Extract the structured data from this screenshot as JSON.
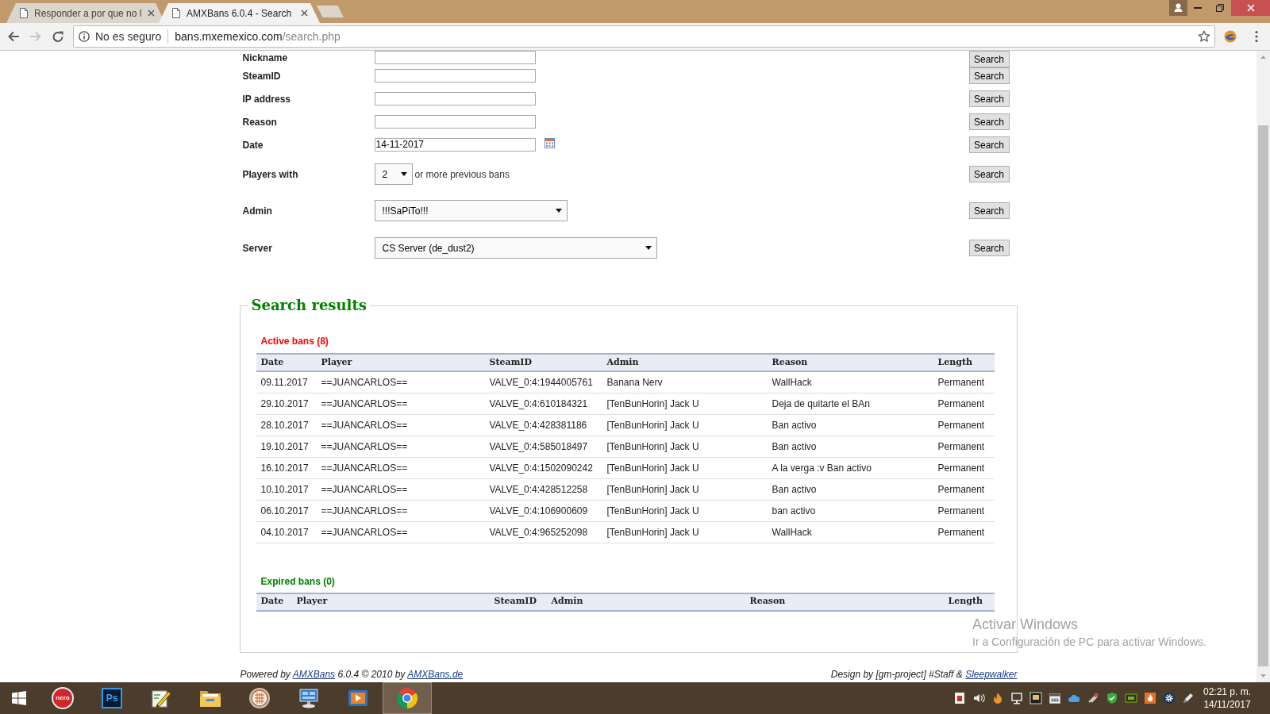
{
  "browser": {
    "tabs": [
      {
        "title": "Responder a por que no l",
        "selected": false
      },
      {
        "title": "AMXBans 6.0.4 - Search",
        "selected": true
      }
    ],
    "security_label": "No es seguro",
    "url_host": "bans.mxemexico.com",
    "url_path": "/search.php"
  },
  "search_form": {
    "rows": [
      {
        "label": "Nickname",
        "kind": "text",
        "button": "Search"
      },
      {
        "label": "SteamID",
        "kind": "text",
        "button": "Search"
      },
      {
        "label": "IP address",
        "kind": "text",
        "button": "Search"
      },
      {
        "label": "Reason",
        "kind": "text",
        "button": "Search"
      },
      {
        "label": "Date",
        "kind": "date",
        "value": "14-11-2017",
        "button": "Search"
      },
      {
        "label": "Players with",
        "kind": "count",
        "value": "2",
        "suffix": "or more previous bans",
        "button": "Search"
      },
      {
        "label": "Admin",
        "kind": "select",
        "value": "!!!SaPiTo!!!",
        "button": "Search"
      },
      {
        "label": "Server",
        "kind": "wideselect",
        "value": "CS Server (de_dust2)",
        "button": "Search"
      }
    ]
  },
  "results": {
    "title": "Search results",
    "sections": [
      {
        "heading": "Active bans (8)",
        "color": "#ff0000",
        "columns": [
          "Date",
          "Player",
          "SteamID",
          "Admin",
          "Reason",
          "Length"
        ],
        "rows": [
          [
            "09.11.2017",
            "==JUANCARLOS==",
            "VALVE_0:4:1944005761",
            "Banana Nerv",
            "WallHack",
            "Permanent"
          ],
          [
            "29.10.2017",
            "==JUANCARLOS==",
            "VALVE_0:4:610184321",
            "[TenBunHorin] Jack U",
            "Deja de quitarte el BAn",
            "Permanent"
          ],
          [
            "28.10.2017",
            "==JUANCARLOS==",
            "VALVE_0:4:428381186",
            "[TenBunHorin] Jack U",
            "Ban activo",
            "Permanent"
          ],
          [
            "19.10.2017",
            "==JUANCARLOS==",
            "VALVE_0:4:585018497",
            "[TenBunHorin] Jack U",
            "Ban activo",
            "Permanent"
          ],
          [
            "16.10.2017",
            "==JUANCARLOS==",
            "VALVE_0:4:1502090242",
            "[TenBunHorin] Jack U",
            "A la verga :v Ban activo",
            "Permanent"
          ],
          [
            "10.10.2017",
            "==JUANCARLOS==",
            "VALVE_0:4:428512258",
            "[TenBunHorin] Jack U",
            "Ban activo",
            "Permanent"
          ],
          [
            "06.10.2017",
            "==JUANCARLOS==",
            "VALVE_0:4:106900609",
            "[TenBunHorin] Jack U",
            "ban activo",
            "Permanent"
          ],
          [
            "04.10.2017",
            "==JUANCARLOS==",
            "VALVE_0:4:965252098",
            "[TenBunHorin] Jack U",
            "WallHack",
            "Permanent"
          ]
        ]
      },
      {
        "heading": "Expired bans (0)",
        "color": "#008000",
        "columns": [
          "Date",
          "Player",
          "SteamID",
          "Admin",
          "Reason",
          "Length"
        ]
      }
    ]
  },
  "footer": {
    "credit": [
      {
        "kind": "text",
        "text": "Powered by"
      },
      {
        "kind": "link",
        "text": "AMXBans"
      },
      {
        "kind": "text",
        "text": "6.0.4 © 2010 by"
      },
      {
        "kind": "link",
        "text": "AMXBans.de"
      }
    ],
    "design_credit": [
      {
        "kind": "text",
        "text": "Design by [gm-project] #Staff &"
      },
      {
        "kind": "link",
        "text": "Sleepwalker"
      }
    ]
  },
  "activation_notice": {
    "title": "Activar Windows",
    "message": "Ir a Configuración de PC para activar Windows."
  },
  "taskbar": {
    "apps": [
      {
        "kind": "disc",
        "label": "nero",
        "selected": false
      },
      {
        "kind": "tile",
        "label": "Ps",
        "selected": false
      },
      {
        "kind": "pencil",
        "selected": false
      },
      {
        "kind": "folder",
        "selected": false
      },
      {
        "kind": "griddisc",
        "selected": false
      },
      {
        "kind": "monitor",
        "selected": false
      },
      {
        "kind": "player",
        "selected": false
      },
      {
        "kind": "browser",
        "selected": true
      }
    ],
    "clock_time": "02:21 p. m.",
    "clock_date": "14/11/2017"
  }
}
